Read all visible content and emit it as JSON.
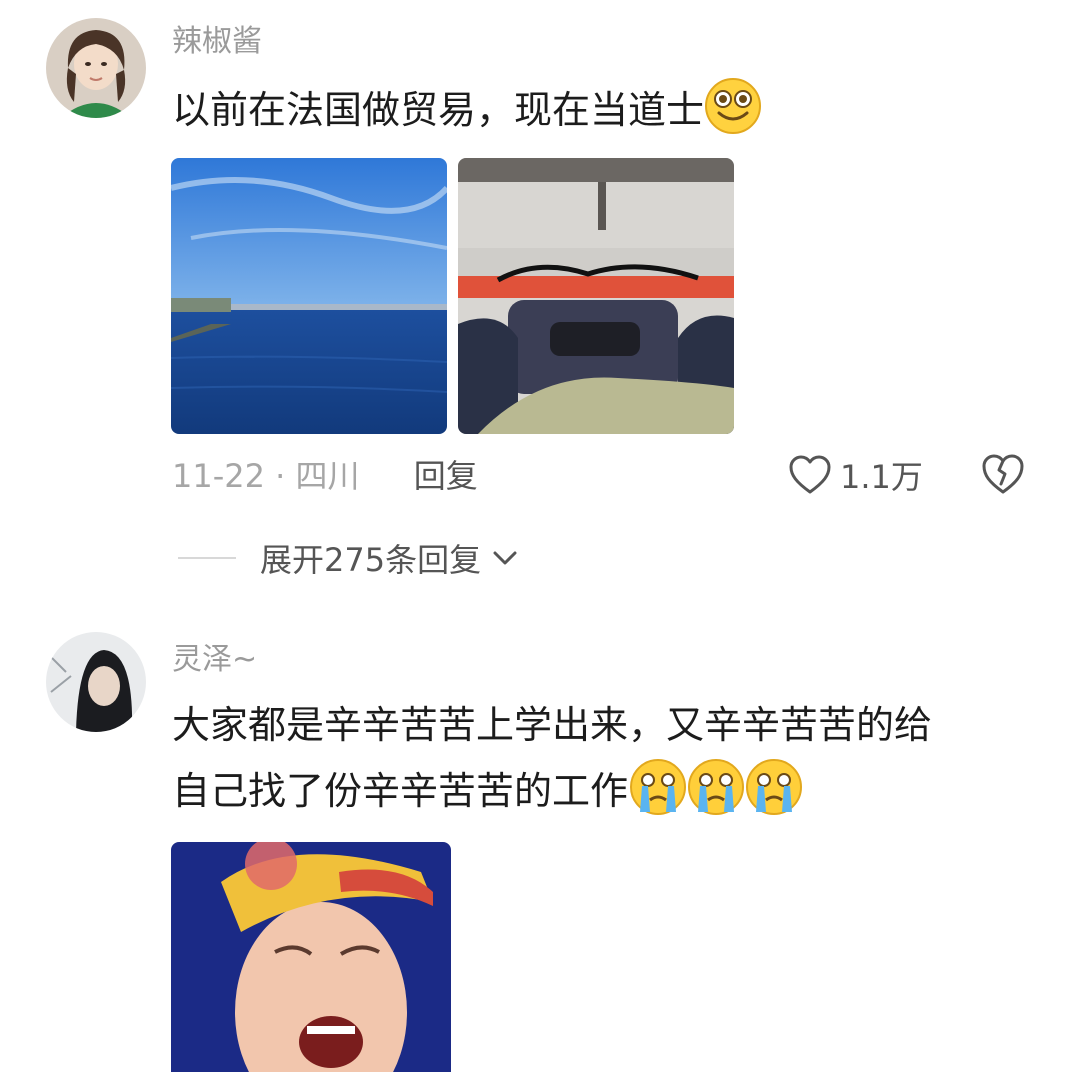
{
  "comments": [
    {
      "username": "辣椒酱",
      "text": "以前在法国做贸易，现在当道士",
      "emoji": "grinning-face-emoji",
      "date": "11-22",
      "separator": "·",
      "location": "四川",
      "reply_label": "回复",
      "like_count": "1.1万",
      "expand_label": "展开275条回复"
    },
    {
      "username": "灵泽~",
      "text_line1": "大家都是辛辛苦苦上学出来，又辛辛苦苦的给",
      "text_line2": "自己找了份辛辛苦苦的工作",
      "emoji": "crying-face-emoji"
    }
  ],
  "icons": {
    "like": "heart-outline-icon",
    "dislike": "broken-heart-icon",
    "expand": "chevron-down-icon"
  },
  "colors": {
    "username": "#9a9a9a",
    "meta": "#a6a6a6",
    "text": "#1c1c1c",
    "action": "#555555"
  }
}
